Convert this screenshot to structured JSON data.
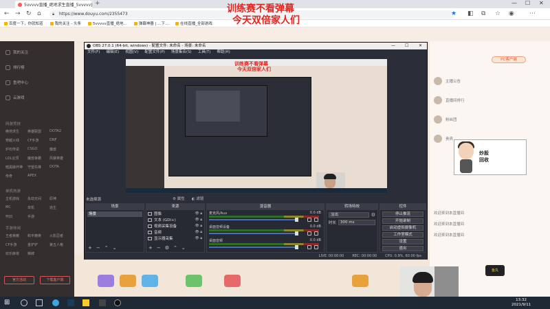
{
  "browser": {
    "tab_title": "5vvvvv直播_绝地求生直播_5vvvvv直播...",
    "new_tab": "+",
    "url": "https://www.douyu.com/2355473",
    "bookmarks": [
      "百度一下，你就知道",
      "我的关注 - 头条",
      "5vvvvv直播_绝地...",
      "弹幕神器 | ...下...",
      "在线直播_全部游戏"
    ]
  },
  "overlay": {
    "line1": "训练赛不看弹幕",
    "line2": "今天双倍家人们"
  },
  "sidebar": {
    "items": [
      "我的关注",
      "排行榜",
      "鱼吧中心",
      "云游戏"
    ],
    "sec1": "网游竞技",
    "grid1": [
      "绝地求生",
      "英雄联盟",
      "DOTA2",
      "穿越火线",
      "CF手游",
      "DNF",
      "炉石传说",
      "CSGO",
      "魔兽",
      "LOL云顶",
      "魔兽争霸",
      "风暴英雄",
      "暗黑破坏神",
      "守望先锋",
      "DOTA",
      "传奇",
      "APEX"
    ],
    "sec2": "单机热游",
    "grid2": [
      "主机游戏",
      "永劫无间",
      "原神",
      "MC",
      "单机",
      "逃生",
      "怀旧",
      "手游"
    ],
    "sec3": "手游休闲",
    "grid3": [
      "王者荣耀",
      "和平精英",
      "火影忍者",
      "CF手游",
      "金铲铲",
      "第五人格",
      "欢乐麻将",
      "棋牌"
    ],
    "btn_left": "官方活动",
    "btn_right": "下载客户端"
  },
  "rightpanel": {
    "pc_badge": "PC客户端",
    "rows": [
      "主播公告",
      "直播间排行",
      "粉丝团",
      "贵宾"
    ],
    "msgs": [
      "欢迎来到本直播间",
      "欢迎来到本直播间",
      "欢迎来到本直播间"
    ]
  },
  "chibi_text": "炒股\n回收",
  "logo_text": "鱼丸",
  "obs": {
    "title": "OBS 27.0.1 (64-bit, windows) - 配置文件: 未命名 - 场景: 未命名",
    "menu": [
      "文件(F)",
      "编辑(E)",
      "视图(V)",
      "配置文件(P)",
      "场景集合(S)",
      "工具(T)",
      "帮助(H)"
    ],
    "preview_overlay1": "训练赛不看弹幕",
    "preview_overlay2": "今天双倍家人们",
    "scenes_label": "未选择源",
    "canvas_btns": [
      "属性",
      "滤镜"
    ],
    "docks": {
      "scenes": "场景",
      "sources": "来源",
      "mixer": "混音器",
      "transitions": "转场特效",
      "controls": "控件"
    },
    "scene_list": [
      "场景"
    ],
    "source_list": [
      "图像",
      "文本 (GDI+)",
      "视频采集设备",
      "音频",
      "显示器采集"
    ],
    "mixer_tracks": [
      {
        "name": "麦克风/Aux",
        "db": "0.0 dB"
      },
      {
        "name": "桌面音频设备",
        "db": "0.0 dB"
      },
      {
        "name": "桌面音频",
        "db": "0.0 dB"
      }
    ],
    "transition": {
      "type": "淡出",
      "duration_label": "时长",
      "duration": "300 ms"
    },
    "controls": [
      "停止推流",
      "开始录制",
      "启动虚拟摄像机",
      "工作室模式",
      "设置",
      "退出"
    ],
    "status": [
      "LIVE: 00:00:00",
      "REC: 00:00:00",
      "CPU: 0.9%, 60.00 fps"
    ]
  },
  "taskbar": {
    "time": "13:32",
    "date": "2021/9/11"
  }
}
